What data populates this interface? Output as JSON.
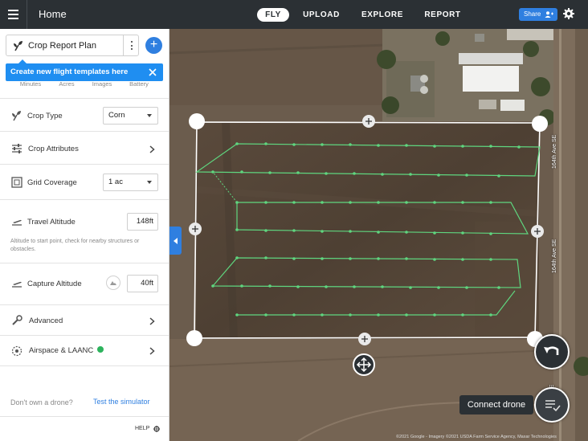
{
  "topbar": {
    "title": "Home",
    "tabs": [
      {
        "label": "FLY",
        "active": true
      },
      {
        "label": "UPLOAD",
        "active": false
      },
      {
        "label": "EXPLORE",
        "active": false
      },
      {
        "label": "REPORT",
        "active": false
      }
    ],
    "share_label": "Share",
    "icons": [
      "menu-icon",
      "add-user-icon",
      "gear-icon"
    ]
  },
  "plan": {
    "name": "Crop Report Plan",
    "tooltip": "Create new flight templates here",
    "stats": [
      "Minutes",
      "Acres",
      "Images",
      "Battery"
    ]
  },
  "settings": {
    "crop_type": {
      "label": "Crop Type",
      "value": "Corn"
    },
    "crop_attributes": {
      "label": "Crop Attributes"
    },
    "grid_coverage": {
      "label": "Grid Coverage",
      "value": "1 ac"
    },
    "travel_altitude": {
      "label": "Travel Altitude",
      "value": "148ft",
      "help": "Altitude to start point, check for nearby structures or obstacles."
    },
    "capture_altitude": {
      "label": "Capture Altitude",
      "value": "40ft"
    },
    "advanced": {
      "label": "Advanced"
    },
    "airspace": {
      "label": "Airspace & LAANC",
      "status_color": "#2db35d"
    }
  },
  "footer": {
    "no_drone": "Don't own a drone?",
    "simulator_link": "Test the simulator",
    "help": "HELP"
  },
  "map": {
    "road_labels": [
      "164th Ave SE",
      "164th Ave SE",
      "SE"
    ],
    "connect_label": "Connect drone",
    "attribution": "©2021 Google - Imagery ©2021 USDA Farm Service Agency, Maxar Technologies"
  },
  "colors": {
    "accent": "#2f7fe0",
    "topbar": "#2b3034",
    "flight_path": "#5fd67f"
  }
}
